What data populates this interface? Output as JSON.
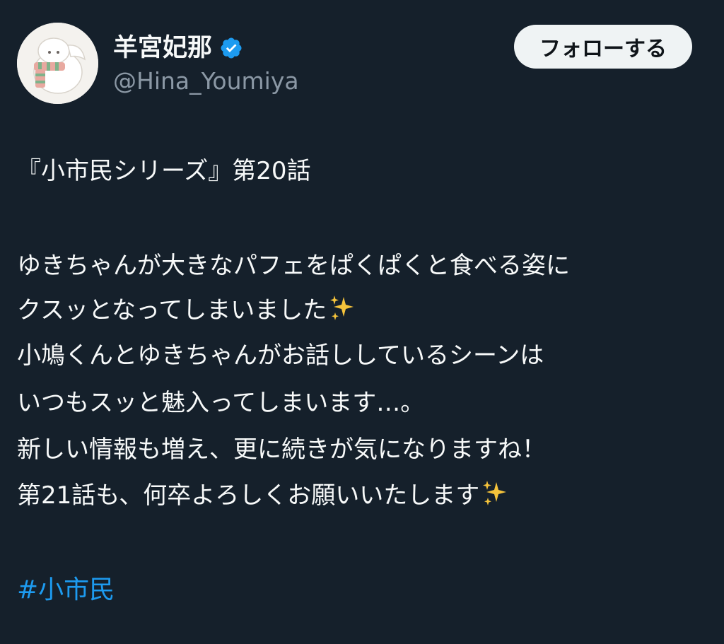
{
  "author": {
    "display_name": "羊宮妃那",
    "handle": "@Hina_Youmiya",
    "verified_icon": "verified-badge-icon",
    "avatar_icon": "avatar-illustration"
  },
  "actions": {
    "follow_label": "フォローする"
  },
  "tweet": {
    "title_line": "『小市民シリーズ』第20話",
    "line1": "ゆきちゃんが大きなパフェをぱくぱくと食べる姿に",
    "line2": "クスッとなってしまいました",
    "line3": "小鳩くんとゆきちゃんがお話ししているシーンは",
    "line4": "いつもスッと魅入ってしまいます…。",
    "line5": "新しい情報も増え、更に続きが気になりますね！",
    "line6": "第21話も、何卒よろしくお願いいたします",
    "emoji": "sparkles-emoji",
    "hashtag": "#小市民"
  },
  "colors": {
    "background": "#15202b",
    "text": "#f7f9f9",
    "muted": "#8b98a5",
    "link": "#1d9bf0",
    "verified": "#1d9bf0",
    "button_bg": "#eff3f4",
    "sparkle": "#f5c33b"
  }
}
